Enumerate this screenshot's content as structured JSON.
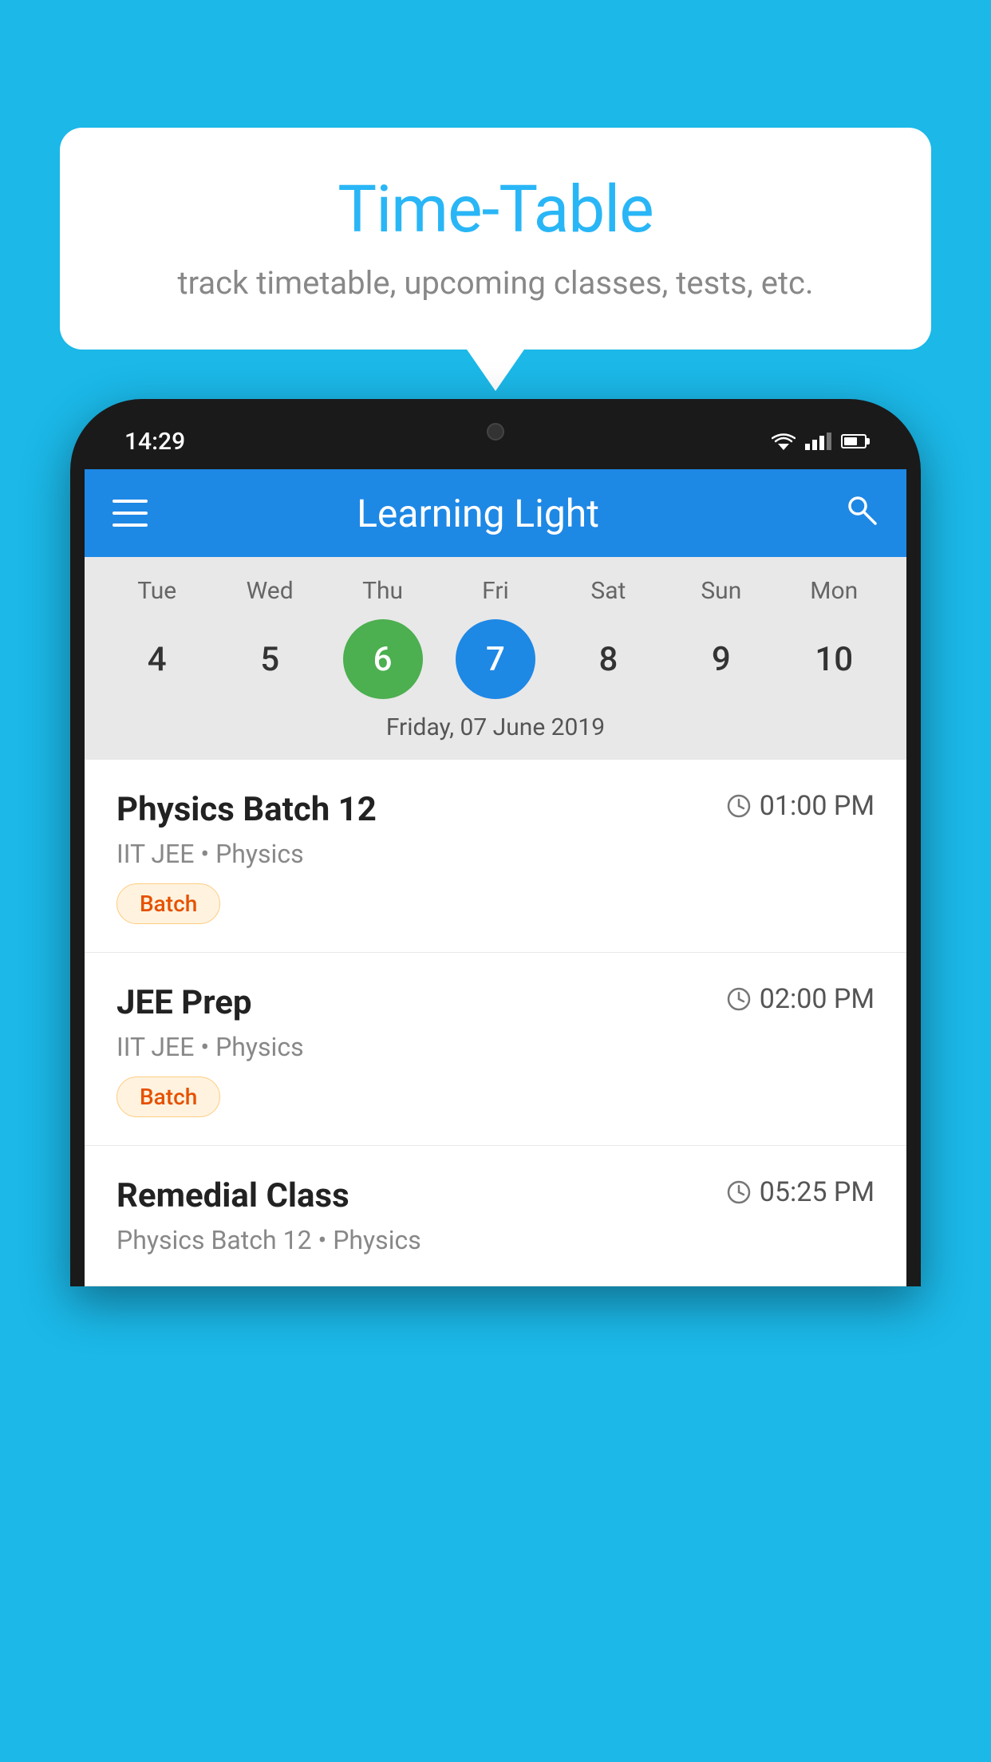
{
  "background_color": "#1BB8E8",
  "speech_bubble": {
    "title": "Time-Table",
    "subtitle": "track timetable, upcoming classes, tests, etc."
  },
  "phone": {
    "status_bar": {
      "time": "14:29"
    },
    "app_bar": {
      "title": "Learning Light",
      "menu_icon": "hamburger-icon",
      "search_icon": "search-icon"
    },
    "calendar": {
      "days": [
        "Tue",
        "Wed",
        "Thu",
        "Fri",
        "Sat",
        "Sun",
        "Mon"
      ],
      "dates": [
        {
          "num": "4",
          "state": "normal"
        },
        {
          "num": "5",
          "state": "normal"
        },
        {
          "num": "6",
          "state": "today"
        },
        {
          "num": "7",
          "state": "selected"
        },
        {
          "num": "8",
          "state": "normal"
        },
        {
          "num": "9",
          "state": "normal"
        },
        {
          "num": "10",
          "state": "normal"
        }
      ],
      "selected_label": "Friday, 07 June 2019"
    },
    "schedule": [
      {
        "title": "Physics Batch 12",
        "time": "01:00 PM",
        "subtitle": "IIT JEE • Physics",
        "badge": "Batch"
      },
      {
        "title": "JEE Prep",
        "time": "02:00 PM",
        "subtitle": "IIT JEE • Physics",
        "badge": "Batch"
      },
      {
        "title": "Remedial Class",
        "time": "05:25 PM",
        "subtitle": "Physics Batch 12 • Physics",
        "badge": null
      }
    ]
  }
}
